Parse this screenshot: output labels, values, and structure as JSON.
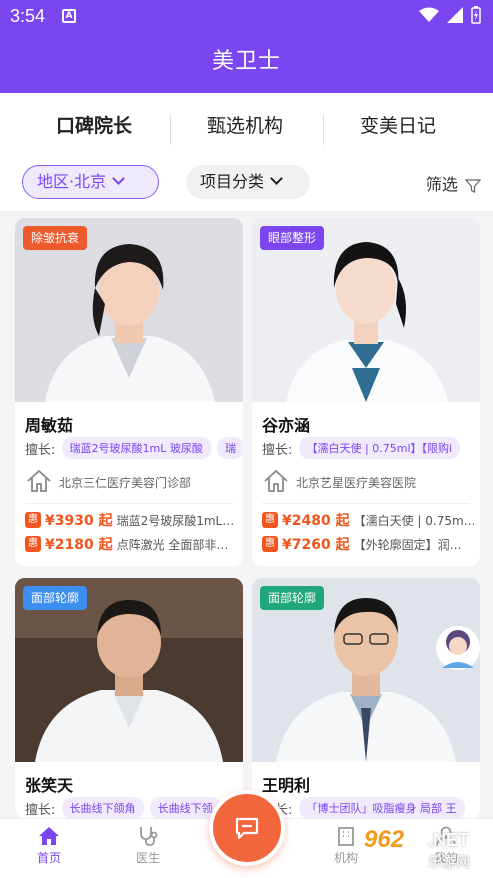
{
  "status_bar": {
    "time": "3:54",
    "notif_letter": "A"
  },
  "header": {
    "title": "美卫士"
  },
  "tabs": [
    {
      "label": "口碑院长",
      "active": true
    },
    {
      "label": "甄选机构",
      "active": false
    },
    {
      "label": "变美日记",
      "active": false
    }
  ],
  "filters": {
    "region": "地区·北京",
    "category": "项目分类",
    "filter_label": "筛选"
  },
  "skill_label": "擅长:",
  "deal_badge": "惠",
  "cards": [
    {
      "tag": "除皱抗衰",
      "tag_color": "#ee5a2b",
      "name": "周敏茹",
      "skills": [
        "瑞蓝2号玻尿酸1mL 玻尿酸",
        "瑞"
      ],
      "institution": "北京三仁医疗美容门诊部",
      "deals": [
        {
          "price": "¥3930 起",
          "desc": "瑞蓝2号玻尿酸1mL…"
        },
        {
          "price": "¥2180 起",
          "desc": "点阵激光 全面部非…"
        }
      ]
    },
    {
      "tag": "眼部整形",
      "tag_color": "#7b46f0",
      "name": "谷亦涵",
      "skills": [
        "【濡白天使 | 0.75ml】【限购i"
      ],
      "institution": "北京艺星医疗美容医院",
      "deals": [
        {
          "price": "¥2480 起",
          "desc": "【濡白天使 | 0.75m…"
        },
        {
          "price": "¥7260 起",
          "desc": "【外轮廓固定】润…"
        }
      ]
    },
    {
      "tag": "面部轮廓",
      "tag_color": "#3d8ef0",
      "name": "张笑天",
      "skills": [
        "长曲线下颌角",
        "长曲线下领"
      ]
    },
    {
      "tag": "面部轮廓",
      "tag_color": "#1fa67a",
      "name": "王明利",
      "skills": [
        "「博士团队」吸脂瘦身 局部 王"
      ]
    }
  ],
  "bottom_nav": [
    {
      "label": "首页",
      "icon": "home-icon",
      "active": true
    },
    {
      "label": "医生",
      "icon": "stethoscope-icon",
      "active": false
    },
    {
      "label": "机构",
      "icon": "building-icon",
      "active": false
    },
    {
      "label": "我的",
      "icon": "user-icon",
      "active": false
    }
  ],
  "watermark": {
    "num": "962",
    "net": ".NET",
    "cn": "乐游网"
  }
}
